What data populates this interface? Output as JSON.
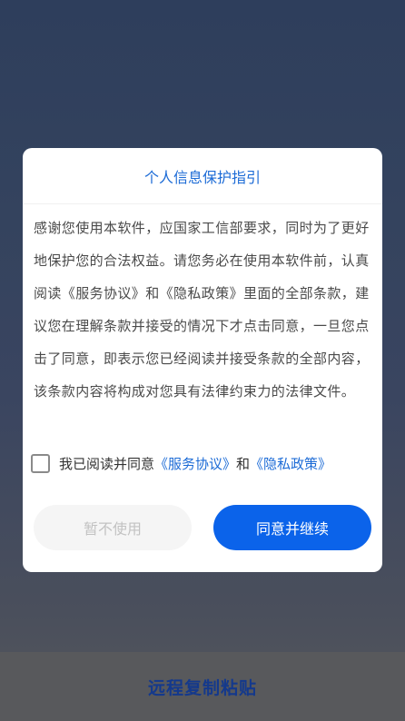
{
  "app": {
    "bottom_title": "远程复制粘贴"
  },
  "dialog": {
    "title": "个人信息保护指引",
    "body": "感谢您使用本软件，应国家工信部要求，同时为了更好地保护您的合法权益。请您务必在使用本软件前，认真阅读《服务协议》和《隐私政策》里面的全部条款，建议您在理解条款并接受的情况下才点击同意，一旦您点击了同意，即表示您已经阅读并接受条款的全部内容，该条款内容将构成对您具有法律约束力的法律文件。",
    "agree_prefix": "我已阅读并同意",
    "service_link": "《服务协议》",
    "agree_and": "和",
    "privacy_link": "《隐私政策》",
    "checkbox_checked": false,
    "decline_label": "暂不使用",
    "accept_label": "同意并继续"
  },
  "colors": {
    "accent": "#0b63ea",
    "link": "#1c6bd6",
    "bottom_title": "#14398c"
  }
}
